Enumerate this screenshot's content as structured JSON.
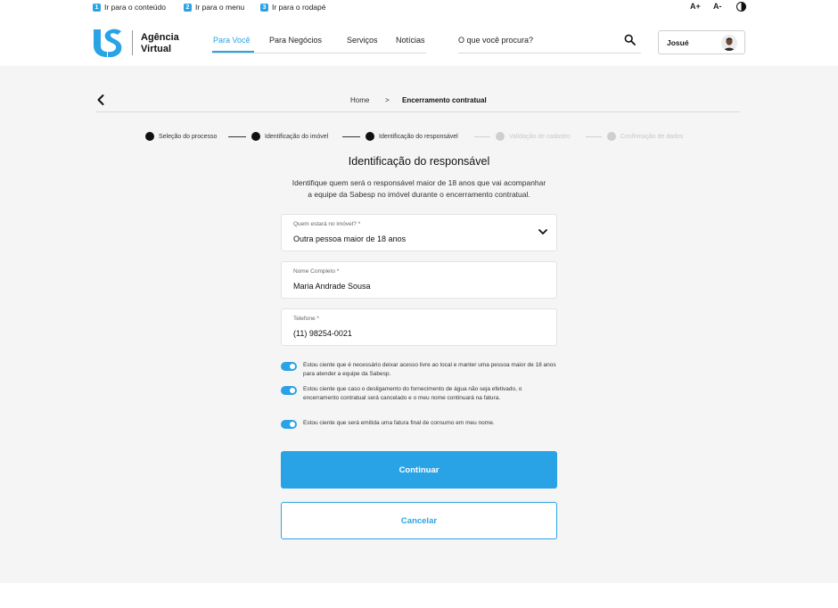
{
  "accessibility_bar": {
    "skip_links": [
      {
        "num": "1",
        "label": "Ir para o conteúdo"
      },
      {
        "num": "2",
        "label": "Ir para o menu"
      },
      {
        "num": "3",
        "label": "Ir para o rodapé"
      }
    ],
    "font_increase": "A+",
    "font_decrease": "A-",
    "contrast_icon": "contrast-icon"
  },
  "header": {
    "brand_line1": "Agência",
    "brand_line2": "Virtual",
    "nav": [
      {
        "label": "Para Você",
        "active": true
      },
      {
        "label": "Para Negócios",
        "active": false
      },
      {
        "label": "Serviços",
        "active": false
      },
      {
        "label": "Notícias",
        "active": false
      }
    ],
    "search_placeholder": "O que você procura?",
    "user_name": "Josué"
  },
  "breadcrumb": {
    "home": "Home",
    "separator": ">",
    "current": "Encerramento contratual"
  },
  "stepper": [
    {
      "label": "Seleção do processo",
      "state": "done"
    },
    {
      "label": "Identificação do imóvel",
      "state": "done"
    },
    {
      "label": "Identificação do responsável",
      "state": "current"
    },
    {
      "label": "Validação de cadastro",
      "state": "pending"
    },
    {
      "label": "Confirmação de dados",
      "state": "pending"
    }
  ],
  "form": {
    "title": "Identificação do responsável",
    "intro_line1": "Identifique quem será o responsável maior de 18 anos que vai acompanhar",
    "intro_line2": "a equipe da Sabesp no imóvel durante o encerramento contratual.",
    "who_label": "Quem estará no imóvel? *",
    "who_value": "Outra pessoa maior de 18 anos",
    "name_label": "Nome Completo *",
    "name_value": "Maria Andrade Sousa",
    "phone_label": "Telefone *",
    "phone_value": "(11) 98254-0021",
    "agreements": [
      "Estou ciente que é necessário deixar acesso livre ao local e manter uma pessoa maior de 18 anos para atender a equipe da Sabesp.",
      "Estou ciente que caso o desligamento do fornecimento de água não seja efetivado, o encerramento contratual será cancelado e o meu nome continuará na fatura.",
      "Estou ciente que será emitida uma fatura final de consumo em meu nome."
    ],
    "continue_label": "Continuar",
    "cancel_label": "Cancelar"
  },
  "colors": {
    "accent": "#2aa3e6",
    "background": "#f5f5f5"
  }
}
